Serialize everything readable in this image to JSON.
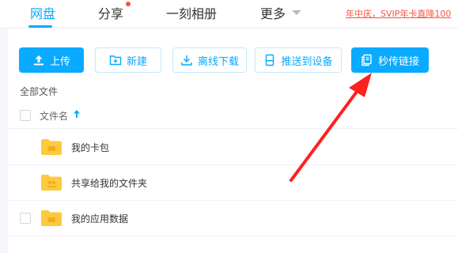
{
  "nav": {
    "tabs": [
      {
        "label": "网盘",
        "active": true
      },
      {
        "label": "分享",
        "badge": true
      },
      {
        "label": "一刻相册"
      },
      {
        "label": "更多",
        "dropdown": true
      }
    ],
    "promo": "年中庆，SVIP年卡直降100"
  },
  "toolbar": {
    "upload": "上传",
    "new_folder": "新建",
    "offline_download": "离线下载",
    "push_to_device": "推送到设备",
    "instant_link": "秒传链接"
  },
  "breadcrumb": "全部文件",
  "table": {
    "column_name": "文件名",
    "rows": [
      {
        "name": "我的卡包",
        "icon": "card-folder-icon"
      },
      {
        "name": "共享给我的文件夹",
        "icon": "shared-folder-icon"
      },
      {
        "name": "我的应用数据",
        "icon": "app-folder-icon"
      }
    ]
  },
  "colors": {
    "accent": "#09aaff",
    "folder": "#ffc93d",
    "annotation": "#ff2020"
  }
}
